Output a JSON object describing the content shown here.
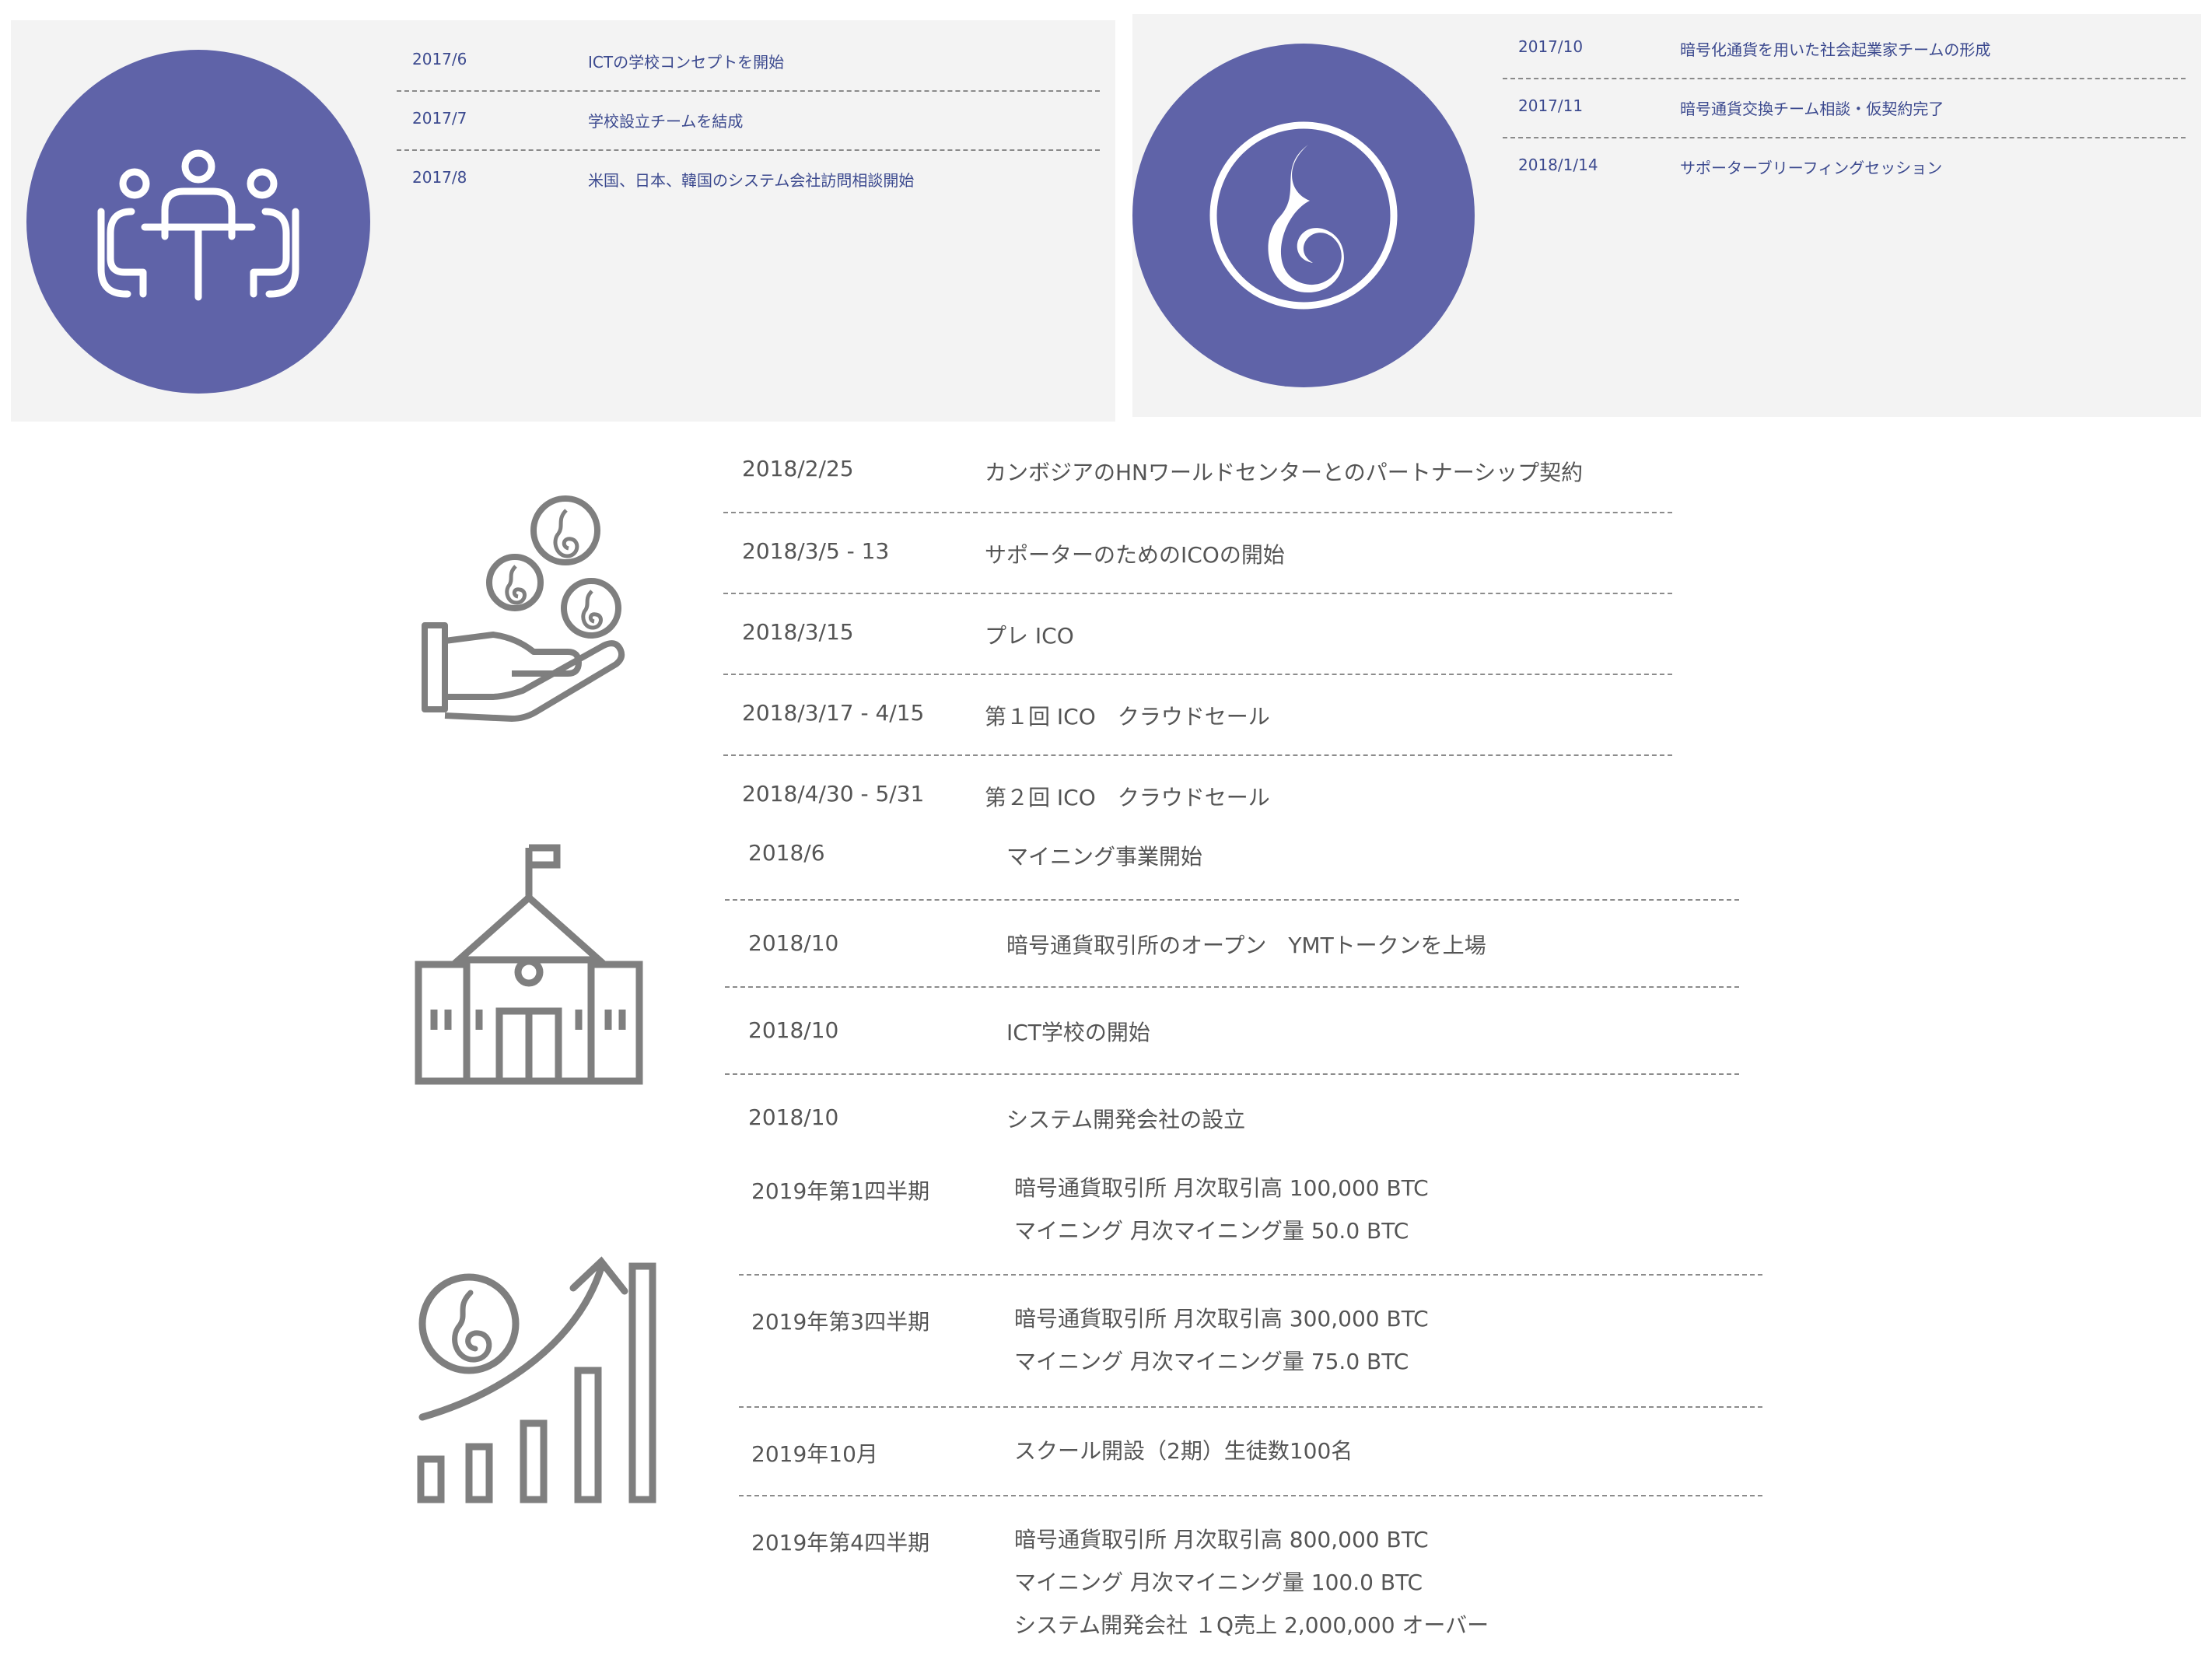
{
  "colors": {
    "panel_bg": "#f3f3f3",
    "circle": "#5f63a8",
    "top_text": "#3c4a8f",
    "body_text": "#555555",
    "icon_gray": "#7f7f7f",
    "divider": "#8c8c8c"
  },
  "icons": {
    "meeting": "meeting-people-icon",
    "coin_logo": "coin-flame-logo-icon",
    "coins_hand": "hand-coins-icon",
    "school": "school-building-icon",
    "growth": "growth-chart-icon"
  },
  "timeline_2017_a": [
    {
      "date": "2017/6",
      "text": "ICTの学校コンセプトを開始"
    },
    {
      "date": "2017/7",
      "text": "学校設立チームを結成"
    },
    {
      "date": "2017/8",
      "text": "米国、日本、韓国のシステム会社訪問相談開始"
    }
  ],
  "timeline_2017_b": [
    {
      "date": "2017/10",
      "text": "暗号化通貨を用いた社会起業家チームの形成"
    },
    {
      "date": "2017/11",
      "text": "暗号通貨交換チーム相談・仮契約完了"
    },
    {
      "date": "2018/1/14",
      "text": "サポーターブリーフィングセッション"
    }
  ],
  "timeline_2018_ico": [
    {
      "date": "2018/2/25",
      "text": "カンボジアのHNワールドセンターとのパートナーシップ契約"
    },
    {
      "date": "2018/3/5 - 13",
      "text": "サポーターのためのICOの開始"
    },
    {
      "date": "2018/3/15",
      "text": "プレ ICO"
    },
    {
      "date": "2018/3/17 - 4/15",
      "text": "第１回 ICO　クラウドセール"
    },
    {
      "date": "2018/4/30 - 5/31",
      "text": "第２回 ICO　クラウドセール"
    }
  ],
  "timeline_2018_biz": [
    {
      "date": "2018/6",
      "text": "マイニング事業開始"
    },
    {
      "date": "2018/10",
      "text": "暗号通貨取引所のオープン　YMTトークンを上場"
    },
    {
      "date": "2018/10",
      "text": "ICT学校の開始"
    },
    {
      "date": "2018/10",
      "text": "システム開発会社の設立"
    }
  ],
  "timeline_2019": [
    {
      "date": "2019年第1四半期",
      "lines": [
        "暗号通貨取引所 月次取引高 100,000 BTC",
        "マイニング 月次マイニング量 50.0 BTC"
      ]
    },
    {
      "date": "2019年第3四半期",
      "lines": [
        "暗号通貨取引所 月次取引高 300,000 BTC",
        "マイニング 月次マイニング量 75.0 BTC"
      ]
    },
    {
      "date": "2019年10月",
      "lines": [
        "スクール開設（2期）生徒数100名"
      ]
    },
    {
      "date": "2019年第4四半期",
      "lines": [
        "暗号通貨取引所 月次取引高 800,000 BTC",
        "マイニング 月次マイニング量 100.0 BTC",
        "システム開発会社 １Q売上 2,000,000 オーバー"
      ]
    }
  ]
}
